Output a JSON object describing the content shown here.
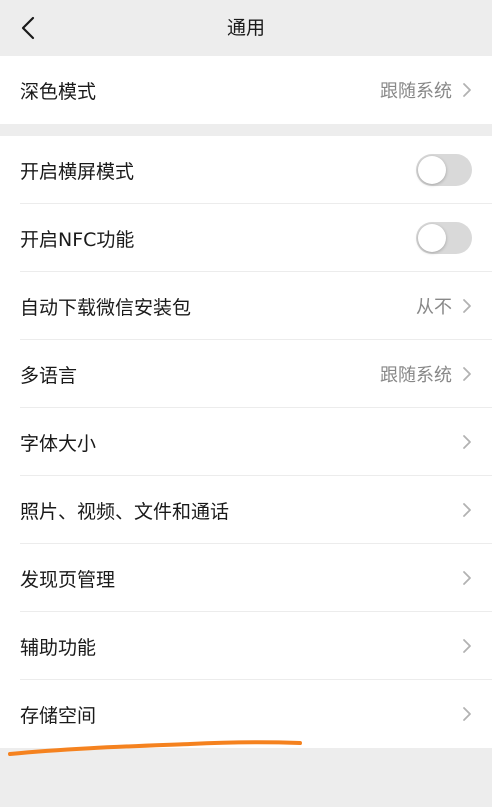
{
  "header": {
    "title": "通用",
    "back_icon": "chevron-left-icon"
  },
  "group1": [
    {
      "label": "深色模式",
      "value": "跟随系统",
      "type": "link"
    }
  ],
  "group2": [
    {
      "label": "开启横屏模式",
      "type": "toggle",
      "on": false
    },
    {
      "label": "开启NFC功能",
      "type": "toggle",
      "on": false
    },
    {
      "label": "自动下载微信安装包",
      "value": "从不",
      "type": "link"
    },
    {
      "label": "多语言",
      "value": "跟随系统",
      "type": "link"
    },
    {
      "label": "字体大小",
      "type": "link"
    },
    {
      "label": "照片、视频、文件和通话",
      "type": "link"
    },
    {
      "label": "发现页管理",
      "type": "link"
    },
    {
      "label": "辅助功能",
      "type": "link"
    },
    {
      "label": "存储空间",
      "type": "link"
    }
  ],
  "colors": {
    "background": "#ededed",
    "card": "#ffffff",
    "secondary_text": "#888888",
    "toggle_off": "#d9d9d9",
    "annotation_stroke": "#f5821f"
  }
}
